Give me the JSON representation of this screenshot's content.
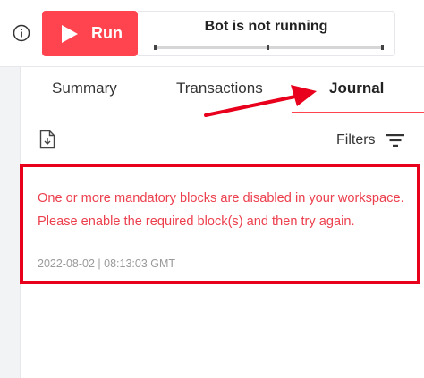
{
  "toolbar": {
    "run_label": "Run",
    "status_text": "Bot is not running",
    "progress_stage": 0
  },
  "tabs": [
    {
      "label": "Summary",
      "active": false
    },
    {
      "label": "Transactions",
      "active": false
    },
    {
      "label": "Journal",
      "active": true
    }
  ],
  "journal": {
    "filters_label": "Filters",
    "entries": [
      {
        "message": "One or more mandatory blocks are disabled in your workspace. Please enable the required block(s) and then try again.",
        "timestamp": "2022-08-02 | 08:13:03 GMT"
      }
    ]
  },
  "colors": {
    "brand_red": "#ff444f",
    "error_text": "#ec3f4d",
    "annotation_red": "#e8001c"
  },
  "icons": {
    "info": "info-icon",
    "run": "play-icon",
    "download": "download-icon",
    "filter": "filter-icon",
    "annotation": "arrow-annotation"
  }
}
